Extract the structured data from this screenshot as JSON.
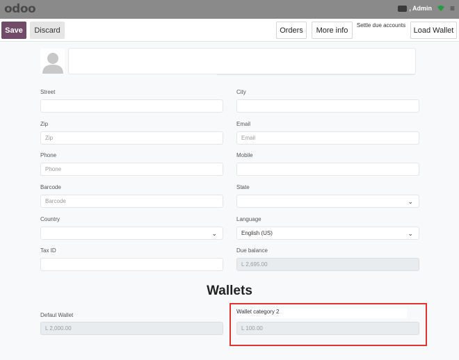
{
  "topbar": {
    "logo": "odoo",
    "user": ", Admin",
    "icons": [
      "cash-icon",
      "wifi-icon",
      "menu-icon"
    ]
  },
  "control": {
    "save": "Save",
    "discard": "Discard",
    "orders": "Orders",
    "more_info": "More info",
    "settle": "Settle due accounts",
    "load_wallet": "Load Wallet"
  },
  "fields": {
    "street": {
      "label": "Street",
      "value": ""
    },
    "city": {
      "label": "City",
      "value": ""
    },
    "zip": {
      "label": "Zip",
      "placeholder": "Zip"
    },
    "email": {
      "label": "Email",
      "placeholder": "Email"
    },
    "phone": {
      "label": "Phone",
      "placeholder": "Phone"
    },
    "mobile": {
      "label": "Mobile",
      "value": ""
    },
    "barcode": {
      "label": "Barcode",
      "placeholder": "Barcode"
    },
    "state": {
      "label": "State",
      "value": ""
    },
    "country": {
      "label": "Country",
      "value": ""
    },
    "language": {
      "label": "Language",
      "value": "English (US)"
    },
    "tax_id": {
      "label": "Tax ID",
      "value": ""
    },
    "due_balance": {
      "label": "Due balance",
      "value": "L 2,695.00"
    }
  },
  "wallets": {
    "title": "Wallets",
    "default": {
      "label": "Defaul Wallet",
      "value": "L 2,000.00"
    },
    "category2": {
      "label": "Wallet category 2",
      "value": "L 100.00"
    }
  },
  "colors": {
    "primary": "#714b67",
    "highlight": "#e0322f",
    "topbar": "#8a8a8a"
  }
}
